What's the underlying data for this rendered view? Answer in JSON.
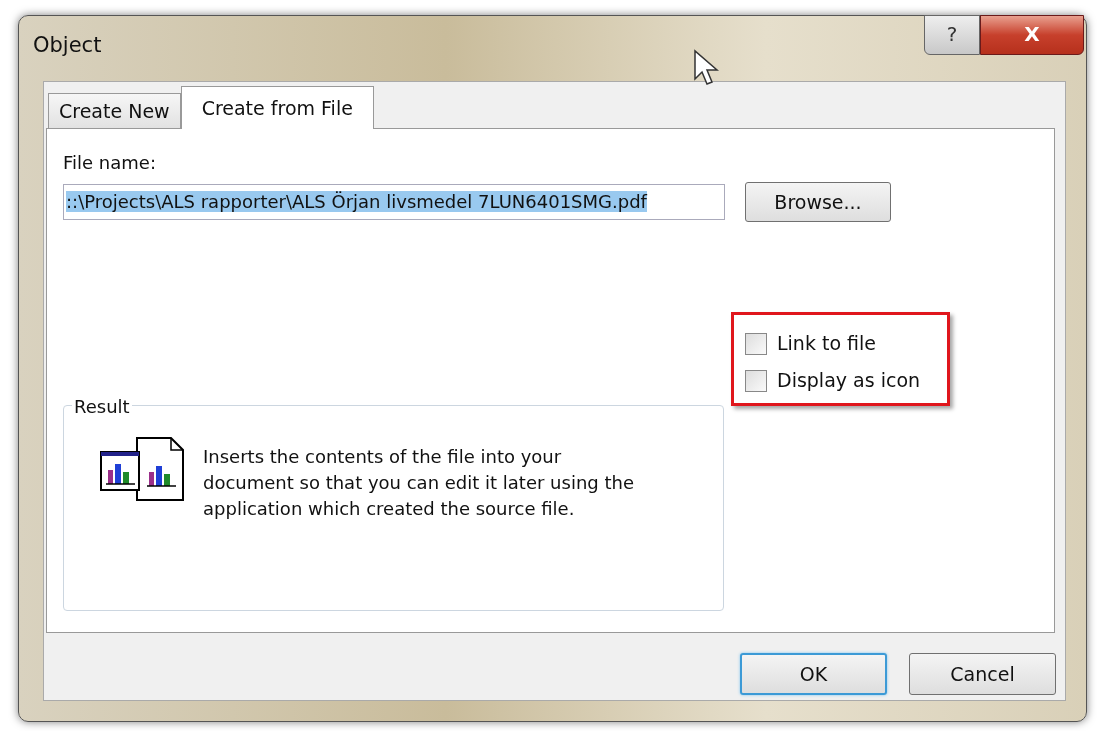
{
  "window": {
    "title": "Object",
    "help_button": "?",
    "close_button": "X"
  },
  "tabs": [
    {
      "label": "Create New",
      "selected": false
    },
    {
      "label": "Create from File",
      "selected": true
    }
  ],
  "file_name": {
    "label": "File name:",
    "value": "::\\Projects\\ALS rapporter\\ALS Örjan livsmedel 7LUN6401SMG.pdf",
    "text_selected": true
  },
  "browse_button": "Browse...",
  "options": [
    {
      "label": "Link to file",
      "checked": false
    },
    {
      "label": "Display as icon",
      "checked": false
    }
  ],
  "result": {
    "title": "Result",
    "description": "Inserts the contents of the file into your document so that you can edit it later using the application which created the source file."
  },
  "buttons": [
    {
      "label": "OK",
      "default": true
    },
    {
      "label": "Cancel",
      "default": false
    }
  ]
}
